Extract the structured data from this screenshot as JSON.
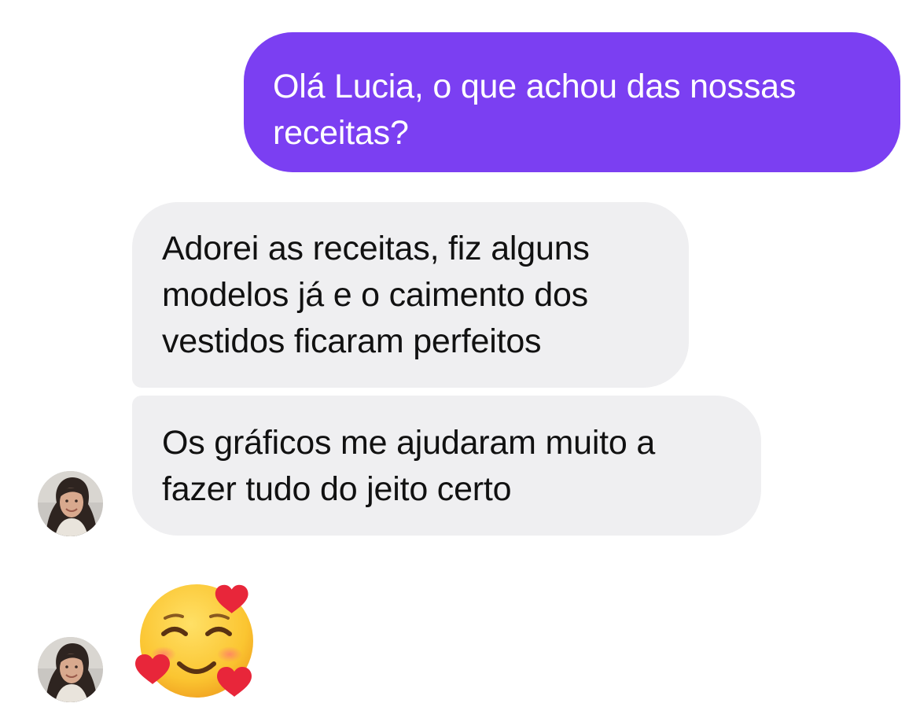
{
  "conversation": {
    "outgoing": {
      "lines": [
        "Olá Lucia, o que achou das nossas",
        "receitas?"
      ],
      "color": "#7b3ff2"
    },
    "incoming": [
      {
        "lines": [
          "Adorei as receitas, fiz alguns",
          "modelos já e o caimento dos",
          "vestidos ficaram perfeitos"
        ]
      },
      {
        "lines": [
          "Os gráficos me ajudaram muito a",
          "fazer tudo do jeito certo"
        ]
      }
    ],
    "incoming_color": "#efeff1",
    "reaction_emoji": {
      "icon": "smiling-face-with-hearts-icon",
      "glyph": "🥰"
    }
  }
}
